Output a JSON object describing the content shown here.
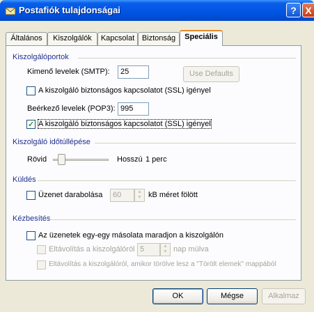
{
  "window": {
    "title": "Postafiók tulajdonságai",
    "help": "?",
    "close": "X"
  },
  "tabs": [
    "Általános",
    "Kiszolgálók",
    "Kapcsolat",
    "Biztonság",
    "Speciális"
  ],
  "ports": {
    "group": "Kiszolgálóportok",
    "smtp_label": "Kimenő levelek (SMTP):",
    "smtp_value": "25",
    "use_defaults": "Use Defaults",
    "smtp_ssl": "A kiszolgáló biztonságos kapcsolatot (SSL) igényel",
    "pop3_label": "Beérkező levelek (POP3):",
    "pop3_value": "995",
    "pop3_ssl": "A kiszolgáló biztonságos kapcsolatot (SSL) igényel"
  },
  "timeout": {
    "group": "Kiszolgáló időtúllépése",
    "short": "Rövid",
    "long": "Hosszú",
    "value": "1 perc",
    "level": 0.1
  },
  "sending": {
    "group": "Küldés",
    "split_label": "Üzenet darabolása",
    "split_value": "60",
    "split_unit": "kB méret fölött"
  },
  "delivery": {
    "group": "Kézbesítés",
    "keep_copy": "Az üzenetek egy-egy másolata maradjon a kiszolgálón",
    "remove_after": "Eltávolítás a kiszolgálóról",
    "days_value": "5",
    "days_unit": "nap múlva",
    "remove_deleted": "Eltávolítás a kiszolgálóról, amikor törölve lesz a \"Törölt elemek\" mappából"
  },
  "buttons": {
    "ok": "OK",
    "cancel": "Mégse",
    "apply": "Alkalmaz"
  },
  "colors": {
    "title_bar": "#0055e5",
    "active_tab_accent": "#e68b2c",
    "group_text": "#1f2f8c"
  }
}
